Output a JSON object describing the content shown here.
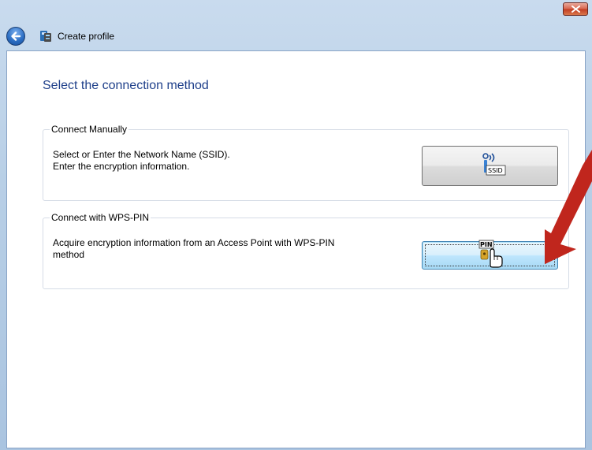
{
  "window": {
    "title": "Create profile",
    "close_label": "×"
  },
  "page": {
    "heading": "Select the connection method"
  },
  "groups": [
    {
      "legend": "Connect Manually",
      "description_line1": "Select or Enter the Network Name (SSID).",
      "description_line2": "Enter the encryption information.",
      "button_icon_text": "SSID"
    },
    {
      "legend": "Connect with WPS-PIN",
      "description_line1": "Acquire encryption information from an Access Point with WPS-PIN",
      "description_line2": "method",
      "button_icon_text": "PIN"
    }
  ],
  "colors": {
    "heading": "#1e3f8a",
    "arrow": "#c0261d",
    "accent": "#3c7fb1"
  },
  "icons": [
    "back-arrow-icon",
    "profile-icon",
    "close-icon",
    "ssid-signal-icon",
    "pin-hand-icon",
    "pointer-arrow"
  ]
}
